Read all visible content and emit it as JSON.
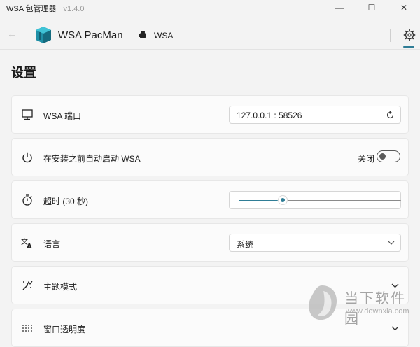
{
  "window": {
    "title": "WSA 包管理器",
    "version": "v1.4.0",
    "min_glyph": "—",
    "max_glyph": "☐",
    "close_glyph": "✕"
  },
  "appbar": {
    "back_glyph": "←",
    "app_name": "WSA PacMan",
    "wsa_label": "WSA",
    "accent": "#2f7d96"
  },
  "page": {
    "title": "设置"
  },
  "settings": {
    "port": {
      "label": "WSA 端口",
      "value": "127.0.0.1 :  58526",
      "icon": "monitor-icon",
      "action_icon": "refresh-icon"
    },
    "autostart": {
      "label": "在安装之前自动启动 WSA",
      "state_label": "关闭",
      "on": false,
      "icon": "power-icon"
    },
    "timeout": {
      "label": "超时 (30 秒)",
      "icon": "timer-icon",
      "slider_fraction": 0.27
    },
    "language": {
      "label": "语言",
      "selected": "系统",
      "icon": "translate-icon"
    },
    "theme": {
      "label": "主题模式",
      "icon": "theme-icon"
    },
    "transparency": {
      "label": "窗口透明度",
      "icon": "dots-grid-icon"
    }
  },
  "watermark": {
    "text": "当下软件园",
    "url": "www.downxia.com"
  }
}
